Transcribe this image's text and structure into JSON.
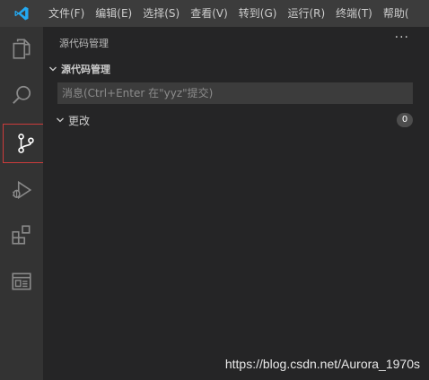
{
  "menu": [
    "文件(F)",
    "编辑(E)",
    "选择(S)",
    "查看(V)",
    "转到(G)",
    "运行(R)",
    "终端(T)",
    "帮助("
  ],
  "activity_bar": {
    "items": [
      {
        "name": "explorer",
        "icon": "files-icon"
      },
      {
        "name": "search",
        "icon": "search-icon"
      },
      {
        "name": "source-control",
        "icon": "source-control-icon",
        "active": true
      },
      {
        "name": "run-debug",
        "icon": "run-debug-icon"
      },
      {
        "name": "extensions",
        "icon": "extensions-icon"
      },
      {
        "name": "remote-explorer",
        "icon": "window-panel-icon"
      }
    ],
    "active_border_color": "#cc3b3b"
  },
  "sidebar": {
    "header": "源代码管理",
    "more": "···",
    "section_title": "源代码管理",
    "commit_placeholder": "消息(Ctrl+Enter 在\"yyz\"提交)",
    "commit_value": "",
    "changes_label": "更改",
    "changes_count": "0"
  },
  "watermark": "https://blog.csdn.net/Aurora_1970s",
  "colors": {
    "titlebar": "#3c3c3c",
    "activitybar": "#333333",
    "sidebar": "#252526",
    "vscode_blue": "#23a9f2"
  }
}
